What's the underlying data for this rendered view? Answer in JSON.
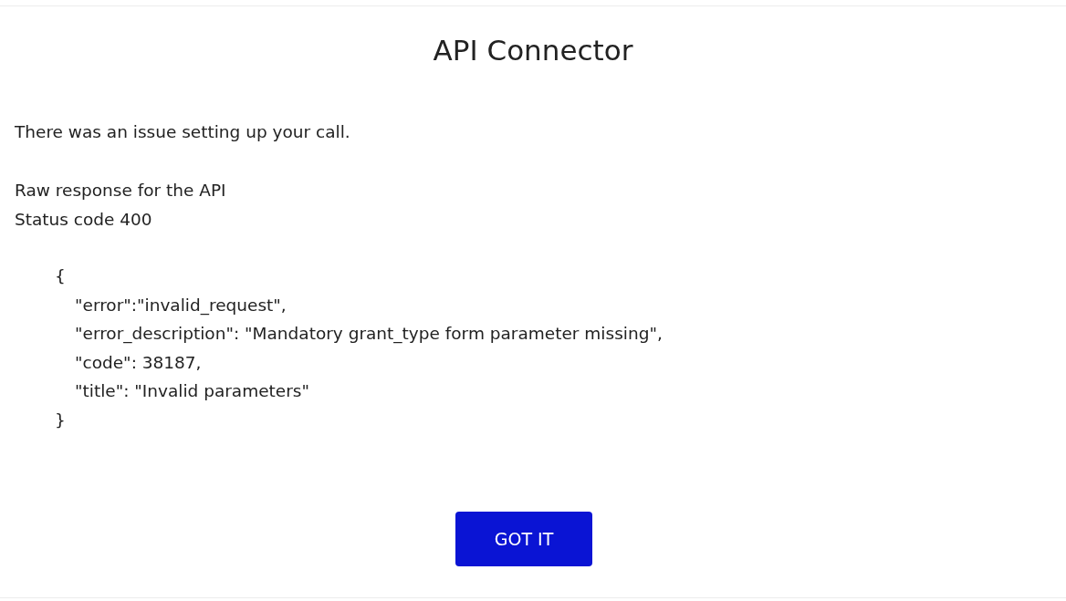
{
  "dialog": {
    "title": "API Connector",
    "message": "There was an issue setting up your call.",
    "details": [
      "Raw response for the API",
      "Status code 400"
    ],
    "response": {
      "open": "{",
      "lines": [
        "\"error\":\"invalid_request\",",
        "\"error_description\": \"Mandatory grant_type form parameter missing\",",
        "\"code\": 38187,",
        "\"title\": \"Invalid parameters\""
      ],
      "close": "}"
    },
    "button": {
      "label": "GOT IT"
    }
  }
}
